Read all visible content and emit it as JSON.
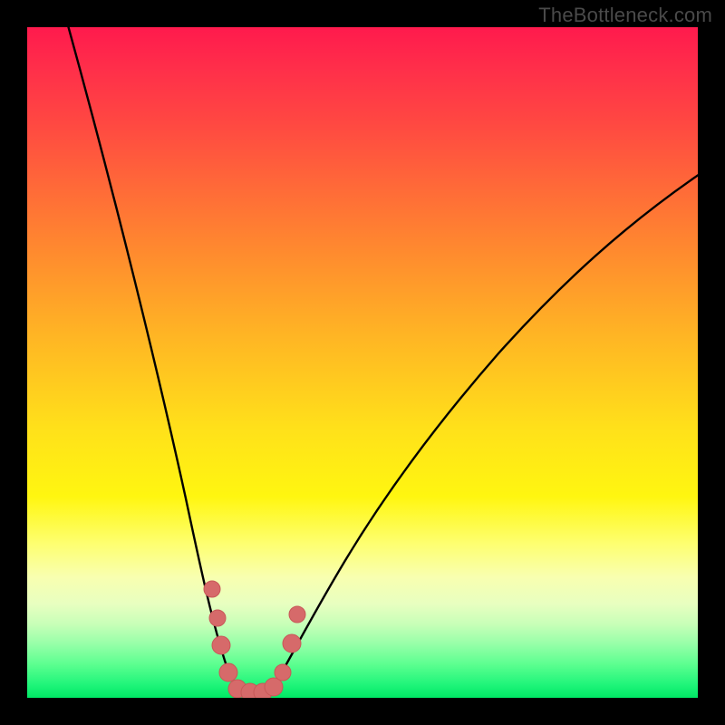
{
  "watermark": "TheBottleneck.com",
  "colors": {
    "page_bg": "#000000",
    "curve_stroke": "#000000",
    "marker_fill": "#d66a6a",
    "marker_stroke": "#c85858",
    "watermark_text": "#4a4a4a"
  },
  "chart_data": {
    "type": "line",
    "title": "",
    "xlabel": "",
    "ylabel": "",
    "xlim": [
      0,
      100
    ],
    "ylim": [
      0,
      100
    ],
    "grid": false,
    "legend": false,
    "background": "rainbow-vertical-gradient (red top → green bottom) representing bottleneck severity",
    "description": "V-shaped bottleneck curve. Left branch descends steeply from top-left toward the minimum near x≈30; right branch rises with decreasing slope toward the upper-right. A short cluster of pink markers sits at the bottom of the V near the optimal/balanced zone.",
    "series": [
      {
        "name": "bottleneck-curve",
        "x": [
          3,
          6,
          9,
          12,
          15,
          18,
          21,
          23,
          25,
          27,
          28,
          29,
          30,
          32,
          34,
          36,
          38,
          41,
          45,
          50,
          56,
          63,
          71,
          80,
          90,
          100
        ],
        "y": [
          100,
          90,
          80,
          70,
          60,
          50,
          40,
          32,
          24,
          16,
          10,
          5,
          2,
          0,
          0,
          2,
          5,
          9,
          15,
          22,
          30,
          39,
          49,
          59,
          69,
          78
        ]
      }
    ],
    "markers": {
      "name": "highlighted-range",
      "x": [
        25.5,
        26.5,
        27.5,
        29.0,
        30.5,
        32.0,
        33.5,
        35.0,
        36.0,
        37.0
      ],
      "y": [
        19,
        14,
        9,
        3,
        1,
        0,
        0,
        2,
        6,
        12
      ]
    }
  }
}
